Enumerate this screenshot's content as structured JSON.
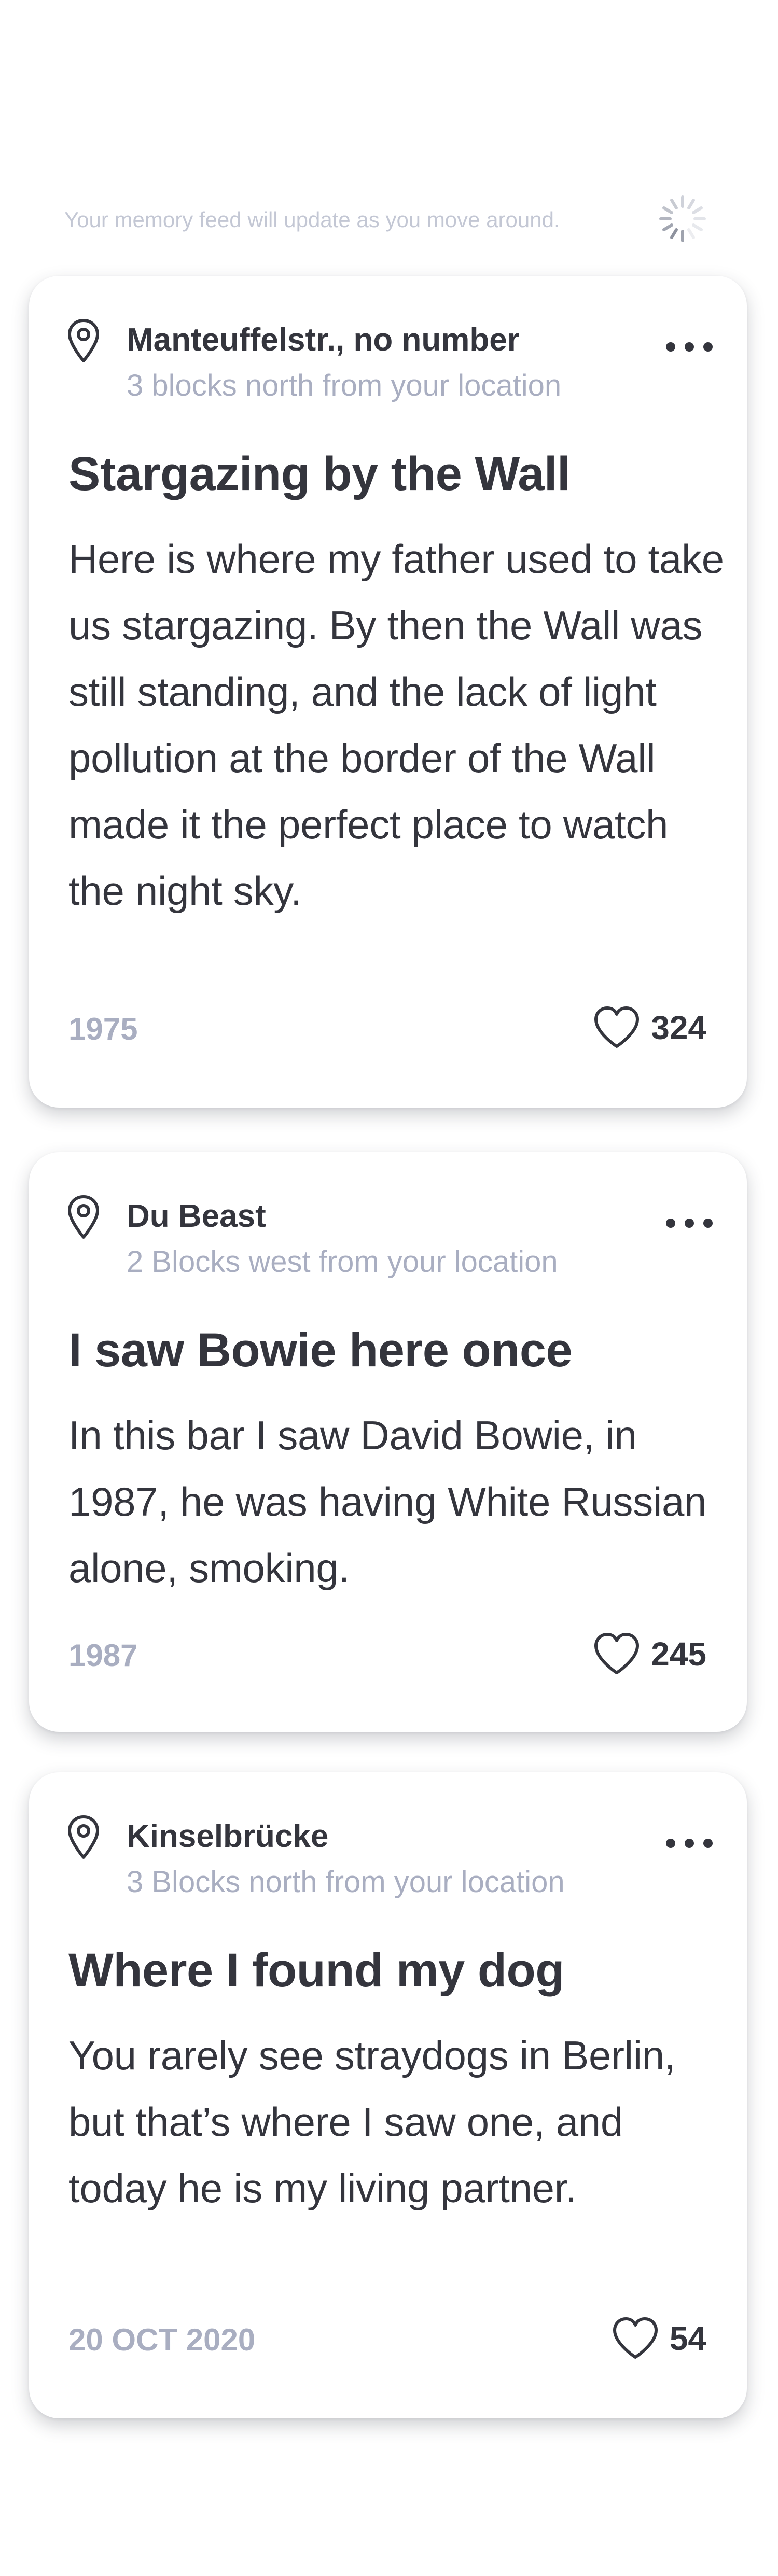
{
  "feed": {
    "status_text": "Your memory feed will update as you move around.",
    "spinner_icon": "loading-spinner-icon"
  },
  "cards": [
    {
      "place": "Manteuffelstr., no number",
      "distance": "3 blocks north from your location",
      "title": "Stargazing by the Wall",
      "body": "Here is where my father used to take us stargazing. By then the Wall was still standing, and the lack of light pollution at the border of the Wall made it the perfect place to watch the night sky.",
      "date": "1975",
      "likes": "324"
    },
    {
      "place": "Du Beast",
      "distance": "2 Blocks west from your location",
      "title": "I saw Bowie here once",
      "body": "In this bar I saw David Bowie, in 1987, he was having White Russian alone, smoking.",
      "date": "1987",
      "likes": "245"
    },
    {
      "place": "Kinselbrücke",
      "distance": "3 Blocks north from your location",
      "title": "Where I found my dog",
      "body": "You rarely see straydogs in Berlin, but that’s where I saw one, and today he is my living partner.",
      "date": "20 OCT 2020",
      "likes": "54"
    }
  ],
  "colors": {
    "text_primary": "#34353d",
    "text_secondary": "#a9aec1",
    "status_text": "#c3c7d4",
    "card_background": "#ffffff"
  }
}
